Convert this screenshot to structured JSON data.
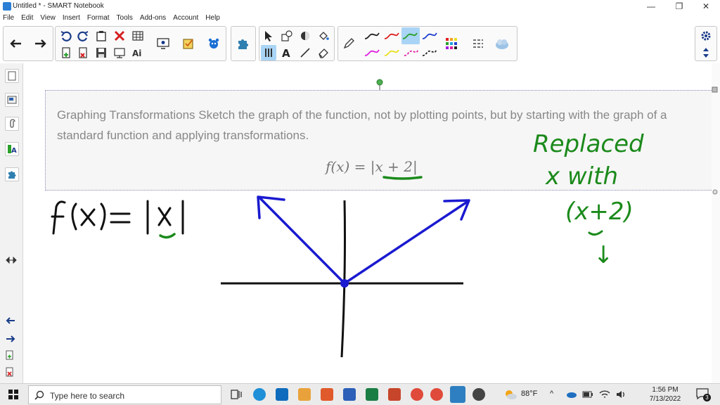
{
  "window": {
    "title": "Untitled * - SMART Notebook",
    "controls": [
      "—",
      "❐",
      "✕"
    ]
  },
  "menu": [
    "File",
    "Edit",
    "View",
    "Insert",
    "Format",
    "Tools",
    "Add-ons",
    "Account",
    "Help"
  ],
  "toolbar": {
    "pen_colors": [
      "#222222",
      "#e02020",
      "#2aa02a",
      "#2040d0",
      "#e020e0",
      "#e8e020",
      "#e020a0",
      "#222222"
    ],
    "selected_pen_color": "#2aa02a"
  },
  "page": {
    "problem_text": "Graphing Transformations Sketch the graph of the function, not by plotting points, but by starting with the graph of a standard function and applying transformations.",
    "formula": "f(x) = |x + 2|"
  },
  "ink": {
    "base_function": "f(x)=|x|",
    "note": [
      "Replaced",
      "x with",
      "(x+2)",
      "↓"
    ],
    "graph_color": "#1a1ad0",
    "ink_color": "#1b8a1b",
    "black": "#111111"
  },
  "taskbar": {
    "search_placeholder": "Type here to search",
    "weather": "88°F",
    "time": "1:56 PM",
    "date": "7/13/2022",
    "notification_count": "3"
  }
}
